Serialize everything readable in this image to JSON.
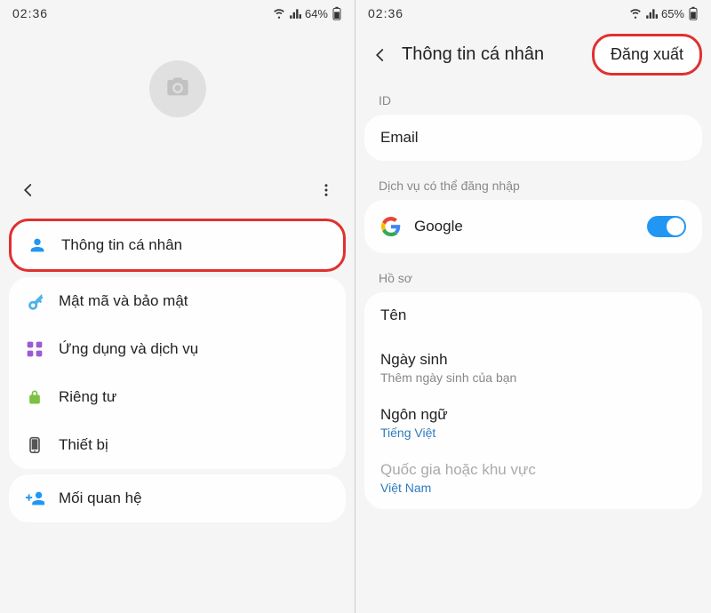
{
  "left": {
    "status": {
      "time": "02:36",
      "battery": "64%"
    },
    "menu": {
      "personal_info": "Thông tin cá nhân",
      "password_security": "Mật mã và bảo mật",
      "apps_services": "Ứng dụng và dịch vụ",
      "privacy": "Riêng tư",
      "device": "Thiết bị",
      "relationship": "Mối quan hệ"
    }
  },
  "right": {
    "status": {
      "time": "02:36",
      "battery": "65%"
    },
    "header": {
      "title": "Thông tin cá nhân",
      "logout": "Đăng xuất"
    },
    "sections": {
      "id_label": "ID",
      "email_label": "Email",
      "services_label": "Dịch vụ có thể đăng nhập",
      "google_label": "Google",
      "profile_label": "Hồ sơ",
      "name_label": "Tên",
      "birthday_label": "Ngày sinh",
      "birthday_hint": "Thêm ngày sinh của bạn",
      "language_label": "Ngôn ngữ",
      "language_value": "Tiếng Việt",
      "region_label": "Quốc gia hoặc khu vực",
      "region_value": "Việt Nam"
    }
  },
  "colors": {
    "highlight": "#e03030",
    "toggle_on": "#2196f3",
    "link": "#2f7bbf"
  },
  "icons": {
    "camera": "camera-icon",
    "person": "person-icon",
    "key": "key-icon",
    "apps": "apps-icon",
    "lock": "lock-icon",
    "device": "device-icon",
    "add_person": "add-person-icon"
  }
}
